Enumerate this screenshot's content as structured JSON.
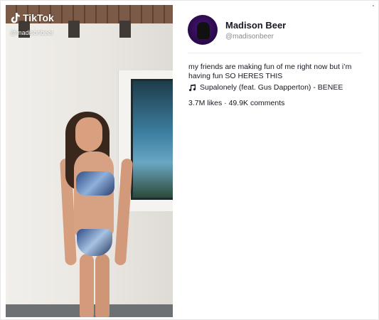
{
  "embed": {
    "brand": "TikTok",
    "video_handle": "@madisonbeer",
    "author": {
      "display_name": "Madison Beer",
      "username": "@madisonbeer"
    },
    "caption": "my friends are making fun of me right now but i’m having fun SO HERES THIS",
    "music": "Supalonely (feat. Gus Dapperton) - BENEE",
    "stats": "3.7M likes · 49.9K comments"
  }
}
